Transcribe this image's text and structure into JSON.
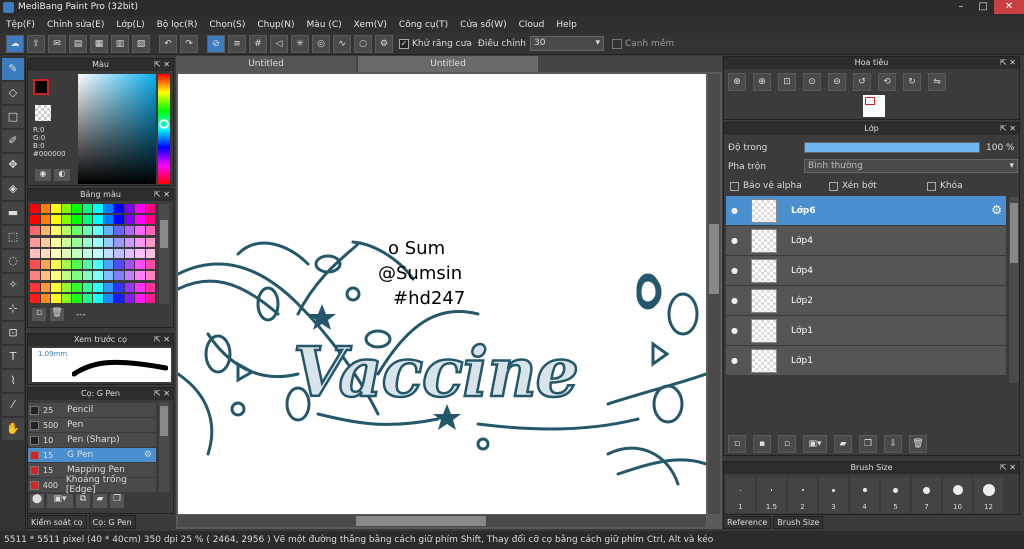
{
  "title": "MediBang Paint Pro (32bit)",
  "window_controls": {
    "minimize": "–",
    "maximize": "□",
    "close": "✕"
  },
  "menu": [
    "Tệp(F)",
    "Chỉnh sửa(E)",
    "Lớp(L)",
    "Bộ lọc(R)",
    "Chọn(S)",
    "Chụp(N)",
    "Màu (C)",
    "Xem(V)",
    "Công cụ(T)",
    "Cửa sổ(W)",
    "Cloud",
    "Help"
  ],
  "toolbar": {
    "antialias_label": "Khử răng cưa",
    "correction_label": "Điều chỉnh",
    "correction_value": "30",
    "snap_label": "Cạnh mềm"
  },
  "left_tools": [
    "brush-icon",
    "eraser-icon",
    "rect-icon",
    "fill-icon",
    "move-icon",
    "bucket-icon",
    "gradient-icon",
    "select-rect-icon",
    "lasso-icon",
    "magic-wand-icon",
    "select-pen-icon",
    "select-eraser-icon",
    "text-icon",
    "divide-icon",
    "eyedropper-icon",
    "hand-icon"
  ],
  "color_panel": {
    "title": "Màu",
    "rgb": {
      "r": "R:0",
      "g": "G:0",
      "b": "B:0"
    },
    "hex": "#000000"
  },
  "palette_panel": {
    "title": "Bảng màu",
    "footer": "---"
  },
  "preview_panel": {
    "title": "Xem trước cọ",
    "size": "1.09mm"
  },
  "brush_panel": {
    "title": "Cọ: G Pen",
    "items": [
      {
        "size": "25",
        "name": "Pencil",
        "color": "#222222"
      },
      {
        "size": "500",
        "name": "Pen",
        "color": "#222222"
      },
      {
        "size": "10",
        "name": "Pen (Sharp)",
        "color": "#222222"
      },
      {
        "size": "15",
        "name": "G Pen",
        "color": "#e02020",
        "selected": true
      },
      {
        "size": "15",
        "name": "Mapping Pen",
        "color": "#e02020"
      },
      {
        "size": "400",
        "name": "Khoảng trống [Edge]",
        "color": "#e02020"
      }
    ]
  },
  "left_tabs": [
    "Kiểm soát cọ",
    "Cọ: G Pen"
  ],
  "doc_tabs": [
    "Untitled",
    "Untitled"
  ],
  "nav_panel": {
    "title": "Hoa tiêu"
  },
  "layer_panel": {
    "title": "Lớp",
    "opacity_label": "Độ trong",
    "opacity_value": "100 %",
    "opacity_fraction": 1.0,
    "blend_label": "Pha trộn",
    "blend_value": "Bình thường",
    "protect_alpha": "Bảo vệ alpha",
    "clipping": "Xén bớt",
    "lock": "Khóa",
    "layers": [
      {
        "name": "Lớp6",
        "selected": true
      },
      {
        "name": "Lớp4"
      },
      {
        "name": "Lớp4"
      },
      {
        "name": "Lớp2"
      },
      {
        "name": "Lớp1"
      },
      {
        "name": "Lớp1"
      }
    ]
  },
  "brush_size_panel": {
    "title": "Brush Size",
    "sizes": [
      "1",
      "1.5",
      "2",
      "3",
      "4",
      "5",
      "7",
      "10",
      "12"
    ]
  },
  "right_tabs": [
    "Reference",
    "Brush Size"
  ],
  "artwork": {
    "signature": [
      "o Sum",
      "@Sumsin",
      "#hd247"
    ],
    "word": "Vaccine"
  },
  "status": "5511 * 5511 pixel  (40 * 40cm)  350 dpi  25 %  ( 2464, 2956 )  Vẽ một đường thẳng bằng cách giữ phím Shift, Thay đổi cỡ cọ bằng cách giữ phím Ctrl, Alt và kéo"
}
